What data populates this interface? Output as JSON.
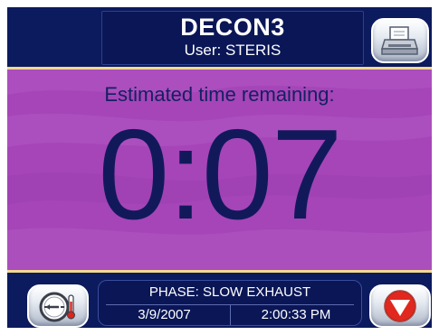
{
  "header": {
    "title": "DECON3",
    "user": "User: STERIS"
  },
  "icons": {
    "print": "printer-icon",
    "gauge": "thermometer-gauge-icon",
    "stop": "stop-triangle-icon"
  },
  "main": {
    "label": "Estimated time remaining:",
    "countdown": "0:07"
  },
  "footer": {
    "phase": "PHASE: SLOW EXHAUST",
    "date": "3/9/2007",
    "time": "2:00:33 PM"
  },
  "colors": {
    "frame": "#0c1a5e",
    "main_background": "#a545b8",
    "accent_divider": "#f4d98f",
    "countdown_text": "#12195a",
    "stop_red": "#e0281f"
  }
}
